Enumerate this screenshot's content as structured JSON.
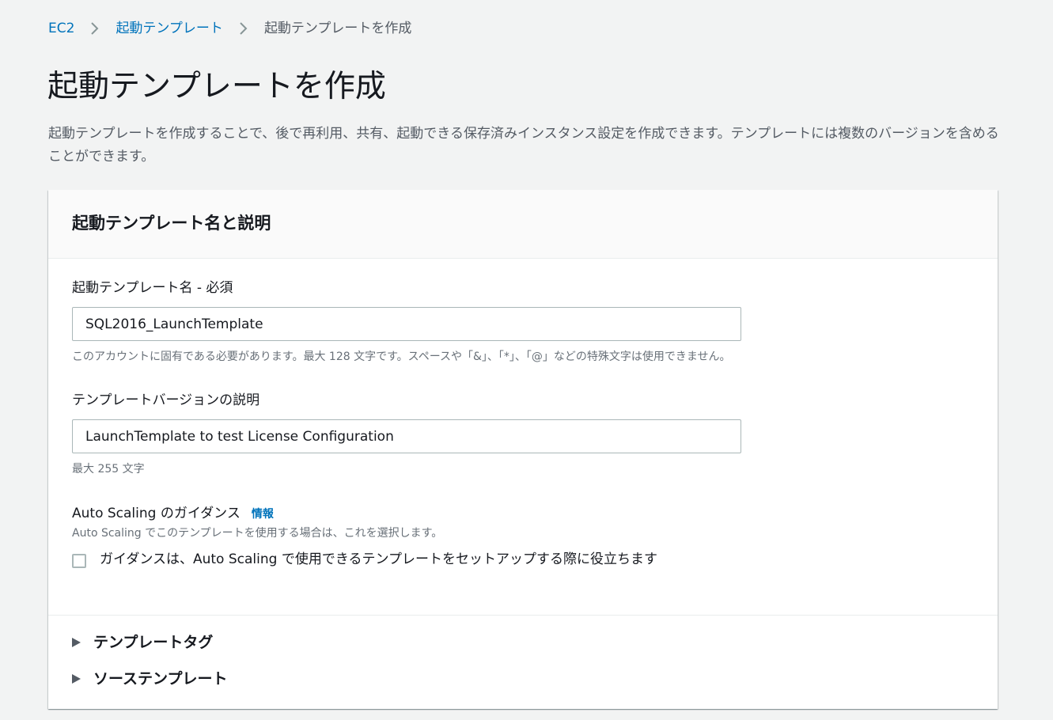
{
  "breadcrumb": {
    "items": [
      "EC2",
      "起動テンプレート"
    ],
    "current": "起動テンプレートを作成"
  },
  "page": {
    "title": "起動テンプレートを作成",
    "description": "起動テンプレートを作成することで、後で再利用、共有、起動できる保存済みインスタンス設定を作成できます。テンプレートには複数のバージョンを含めることができます。"
  },
  "panel": {
    "title": "起動テンプレート名と説明",
    "name_field": {
      "label": "起動テンプレート名 - 必須",
      "value": "SQL2016_LaunchTemplate",
      "hint": "このアカウントに固有である必要があります。最大 128 文字です。スペースや「&」、「*」、「@」などの特殊文字は使用できません。"
    },
    "version_field": {
      "label": "テンプレートバージョンの説明",
      "value": "LaunchTemplate to test License Configuration",
      "hint": "最大 255 文字"
    },
    "autoscaling": {
      "label": "Auto Scaling のガイダンス",
      "info_link": "情報",
      "hint": "Auto Scaling でこのテンプレートを使用する場合は、これを選択します。",
      "checkbox_label": "ガイダンスは、Auto Scaling で使用できるテンプレートをセットアップする際に役立ちます",
      "checked": false
    },
    "expanders": [
      "テンプレートタグ",
      "ソーステンプレート"
    ]
  },
  "colors": {
    "link": "#0073bb",
    "background": "#f2f3f3",
    "text": "#16191f",
    "secondary_text": "#545b64"
  }
}
